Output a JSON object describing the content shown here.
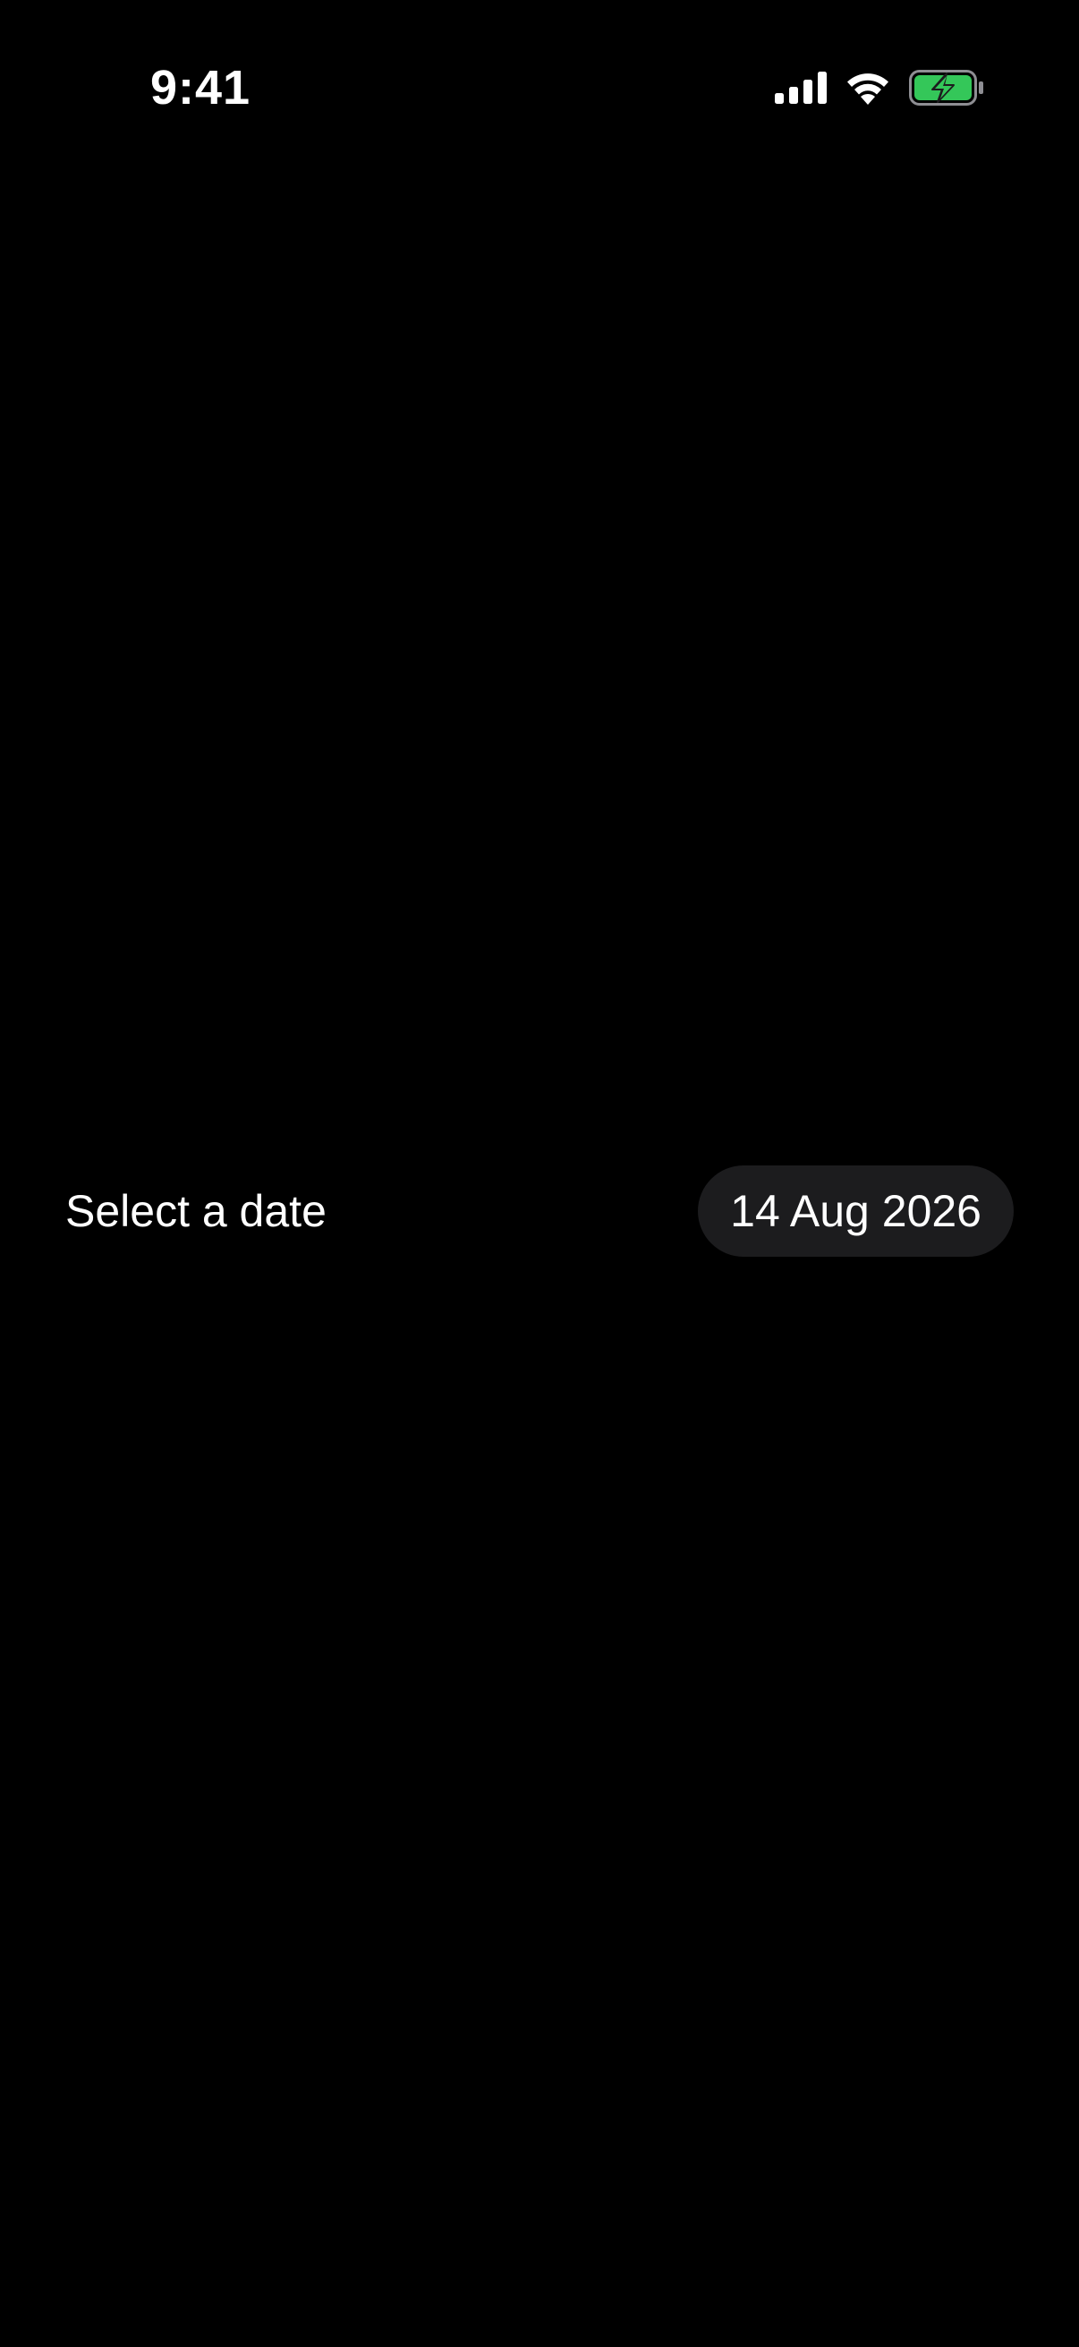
{
  "status_bar": {
    "time": "9:41",
    "icons": [
      "cellular-signal-icon",
      "wifi-icon",
      "battery-charging-icon"
    ],
    "battery_color": "#34c759"
  },
  "date_row": {
    "label": "Select a date",
    "value": "14 Aug 2026"
  },
  "colors": {
    "background": "#000000",
    "pill_background": "#1c1c1e",
    "text": "#ffffff"
  }
}
